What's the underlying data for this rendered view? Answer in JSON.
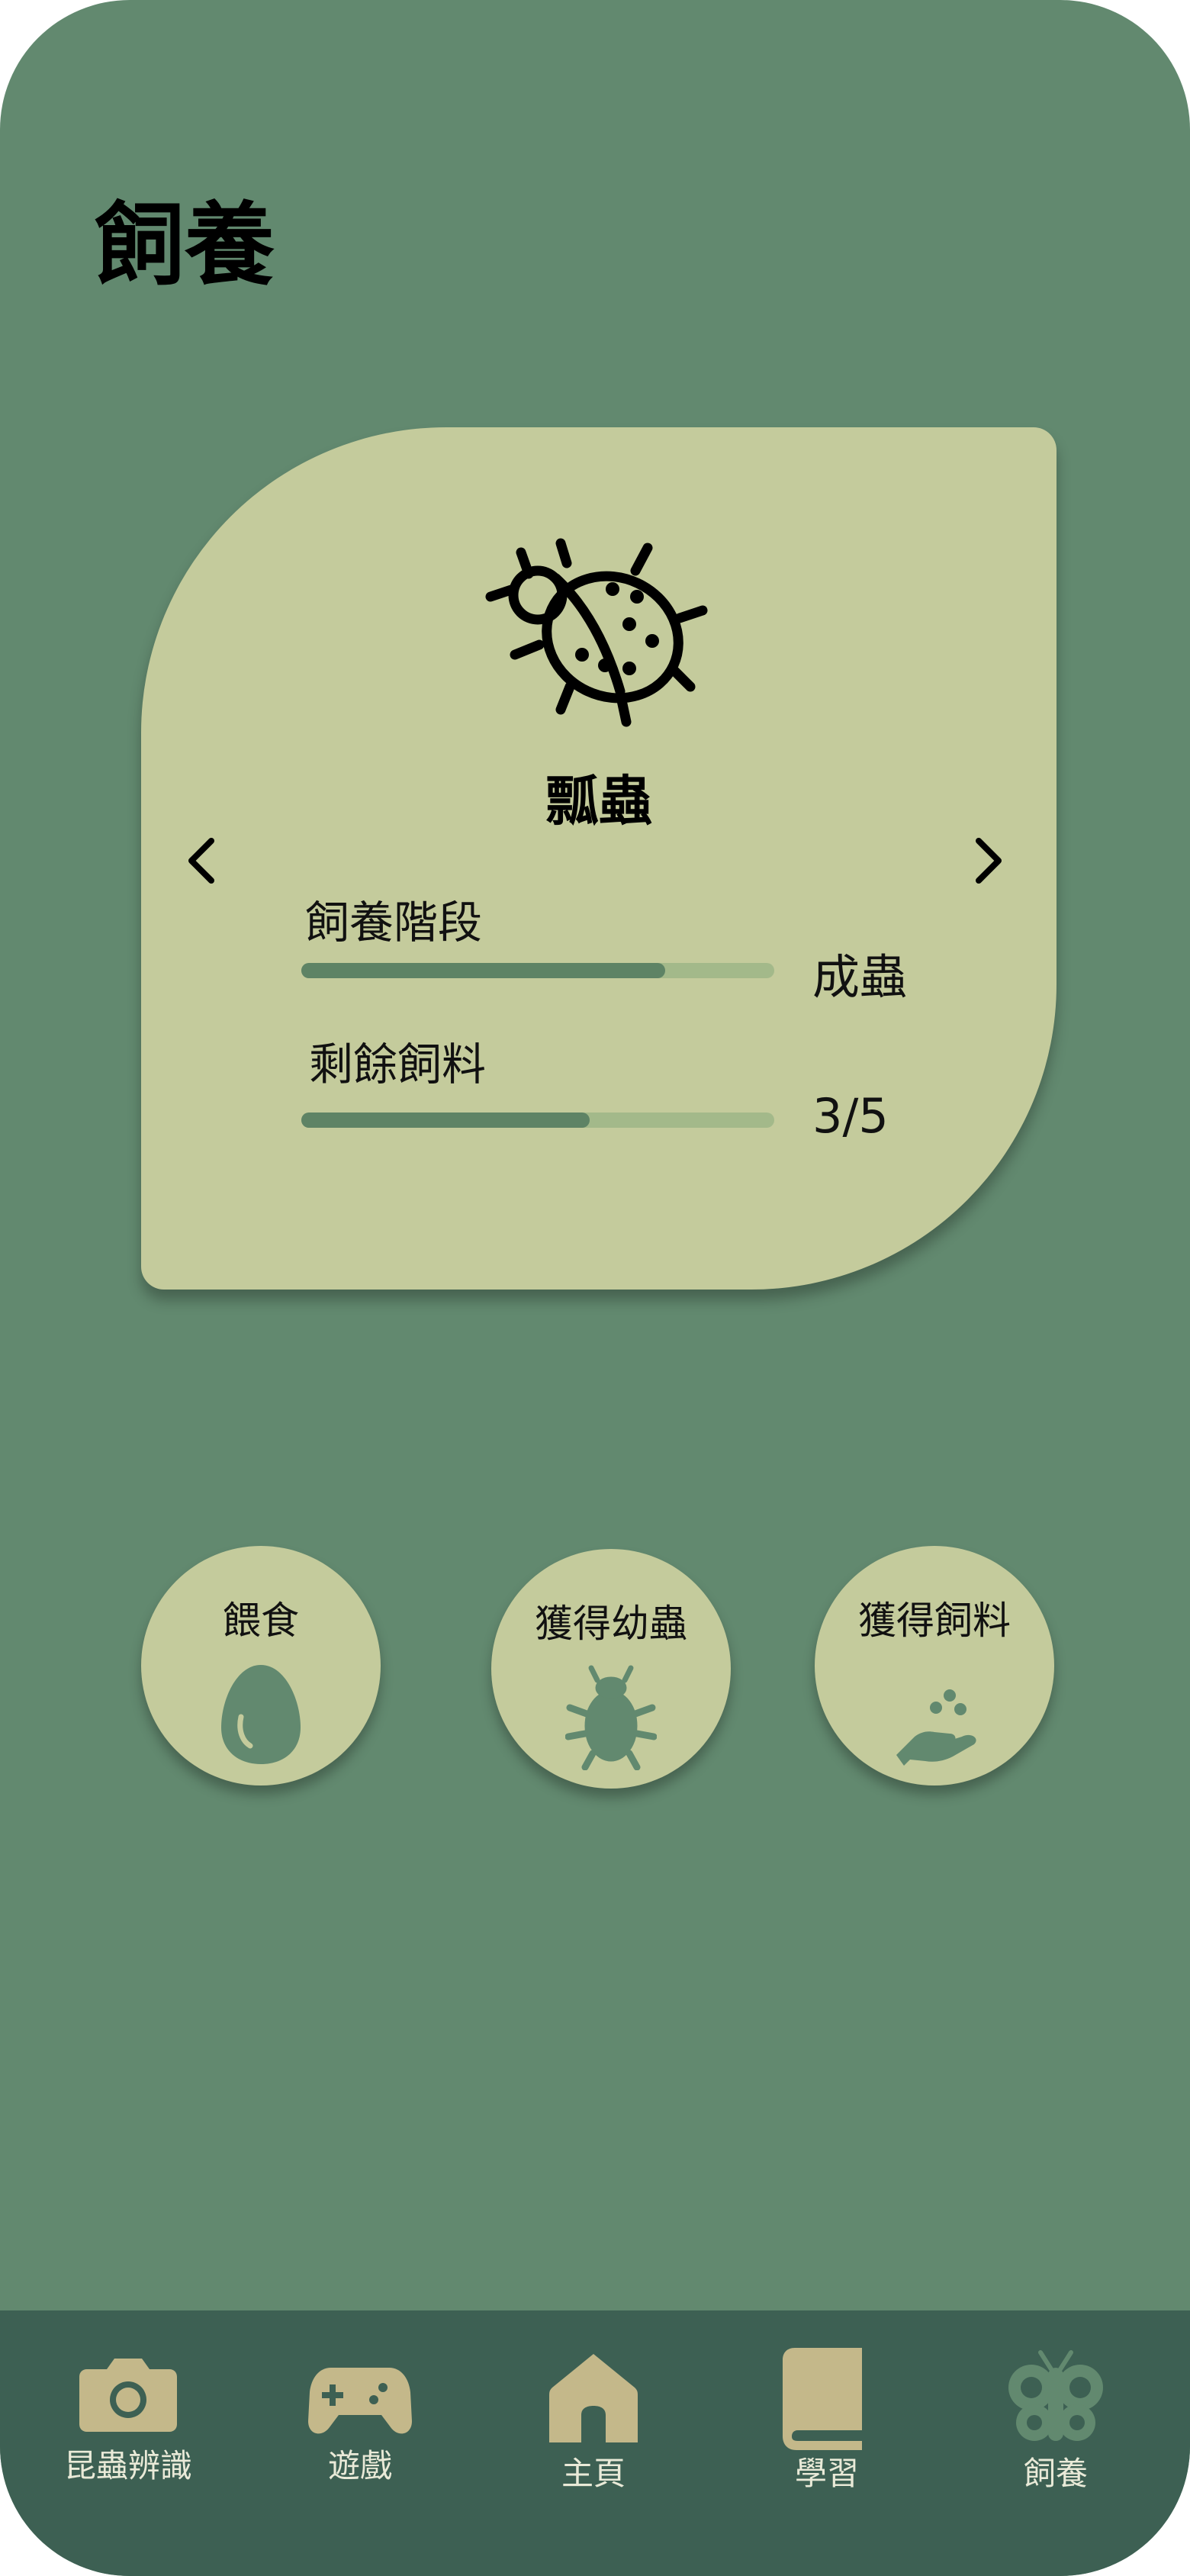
{
  "page": {
    "title": "飼養"
  },
  "card": {
    "insect_name": "瓢蟲",
    "stage": {
      "label": "飼養階段",
      "value": "成蟲",
      "progress": 0.77
    },
    "food": {
      "label": "剩餘飼料",
      "value": "3/5",
      "progress": 0.61
    }
  },
  "actions": [
    {
      "label": "餵食",
      "icon": "egg-icon"
    },
    {
      "label": "獲得幼蟲",
      "icon": "bug-silhouette-icon"
    },
    {
      "label": "獲得飼料",
      "icon": "hand-feed-icon"
    }
  ],
  "tabs": [
    {
      "label": "昆蟲辨識",
      "icon": "camera-icon"
    },
    {
      "label": "遊戲",
      "icon": "gamepad-icon"
    },
    {
      "label": "主頁",
      "icon": "home-icon"
    },
    {
      "label": "學習",
      "icon": "book-icon"
    },
    {
      "label": "飼養",
      "icon": "butterfly-icon",
      "active": true
    }
  ],
  "colors": {
    "background": "#62896f",
    "card": "#c4cb9c",
    "tabbar": "#3d6053",
    "bar_fill": "#5e8365",
    "bar_track": "#a3b98a",
    "tab_icon": "#c4b88a",
    "tab_active": "#62896f"
  }
}
